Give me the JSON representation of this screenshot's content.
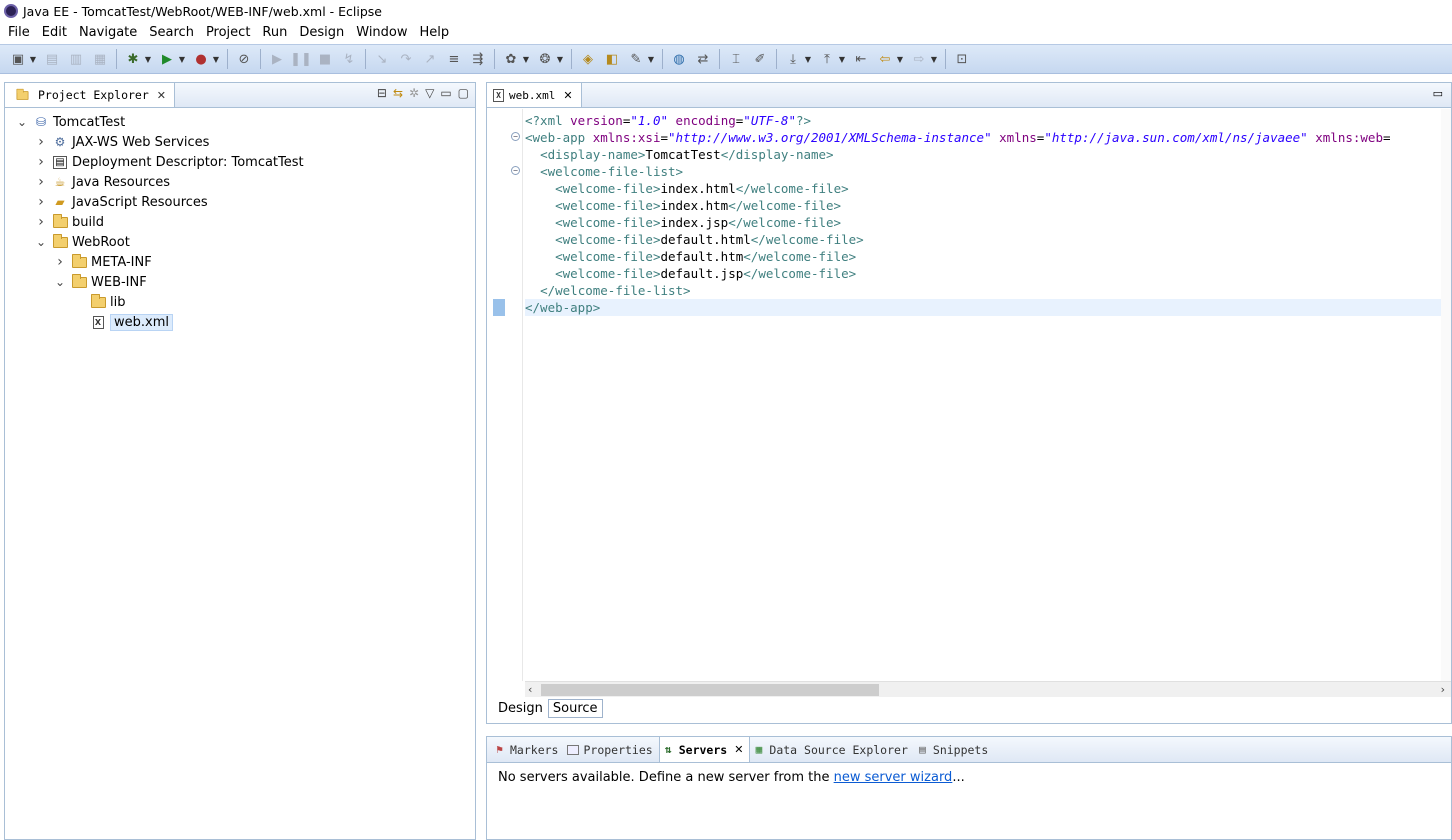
{
  "window": {
    "title": "Java EE - TomcatTest/WebRoot/WEB-INF/web.xml - Eclipse"
  },
  "menu": [
    "File",
    "Edit",
    "Navigate",
    "Search",
    "Project",
    "Run",
    "Design",
    "Window",
    "Help"
  ],
  "project_explorer": {
    "tab_label": "Project Explorer",
    "tree": [
      {
        "label": "TomcatTest",
        "level": 0,
        "twisty": "open",
        "icon": "project-icon"
      },
      {
        "label": "JAX-WS Web Services",
        "level": 1,
        "twisty": "closed",
        "icon": "webservice-icon"
      },
      {
        "label": "Deployment Descriptor: TomcatTest",
        "level": 1,
        "twisty": "closed",
        "icon": "descriptor-icon"
      },
      {
        "label": "Java Resources",
        "level": 1,
        "twisty": "closed",
        "icon": "java-resources-icon"
      },
      {
        "label": "JavaScript Resources",
        "level": 1,
        "twisty": "closed",
        "icon": "javascript-resources-icon"
      },
      {
        "label": "build",
        "level": 1,
        "twisty": "closed",
        "icon": "folder-icon"
      },
      {
        "label": "WebRoot",
        "level": 1,
        "twisty": "open",
        "icon": "folder-icon"
      },
      {
        "label": "META-INF",
        "level": 2,
        "twisty": "closed",
        "icon": "folder-icon"
      },
      {
        "label": "WEB-INF",
        "level": 2,
        "twisty": "open",
        "icon": "folder-icon"
      },
      {
        "label": "lib",
        "level": 3,
        "twisty": "none",
        "icon": "folder-icon"
      },
      {
        "label": "web.xml",
        "level": 3,
        "twisty": "none",
        "icon": "xml-file-icon",
        "selected": true
      }
    ]
  },
  "editor": {
    "tab_label": "web.xml",
    "bottom_tabs": [
      "Design",
      "Source"
    ],
    "active_bottom_tab": "Source",
    "lines": [
      [
        {
          "c": "tag",
          "t": "<?xml "
        },
        {
          "c": "attr",
          "t": "version"
        },
        {
          "c": "txt",
          "t": "="
        },
        {
          "c": "val",
          "t": "\"1.0\""
        },
        {
          "c": "txt",
          "t": " "
        },
        {
          "c": "attr",
          "t": "encoding"
        },
        {
          "c": "txt",
          "t": "="
        },
        {
          "c": "val",
          "t": "\"UTF-8\""
        },
        {
          "c": "tag",
          "t": "?>"
        }
      ],
      [
        {
          "c": "tag",
          "t": "<web-app "
        },
        {
          "c": "attr",
          "t": "xmlns:xsi"
        },
        {
          "c": "txt",
          "t": "="
        },
        {
          "c": "val",
          "t": "\"http://www.w3.org/2001/XMLSchema-instance\""
        },
        {
          "c": "txt",
          "t": " "
        },
        {
          "c": "attr",
          "t": "xmlns"
        },
        {
          "c": "txt",
          "t": "="
        },
        {
          "c": "val",
          "t": "\"http://java.sun.com/xml/ns/javaee\""
        },
        {
          "c": "txt",
          "t": " "
        },
        {
          "c": "attr",
          "t": "xmlns:web"
        },
        {
          "c": "txt",
          "t": "="
        }
      ],
      [
        {
          "c": "txt",
          "t": "  "
        },
        {
          "c": "tag",
          "t": "<display-name>"
        },
        {
          "c": "txt",
          "t": "TomcatTest"
        },
        {
          "c": "tag",
          "t": "</display-name>"
        }
      ],
      [
        {
          "c": "txt",
          "t": "  "
        },
        {
          "c": "tag",
          "t": "<welcome-file-list>"
        }
      ],
      [
        {
          "c": "txt",
          "t": "    "
        },
        {
          "c": "tag",
          "t": "<welcome-file>"
        },
        {
          "c": "txt",
          "t": "index.html"
        },
        {
          "c": "tag",
          "t": "</welcome-file>"
        }
      ],
      [
        {
          "c": "txt",
          "t": "    "
        },
        {
          "c": "tag",
          "t": "<welcome-file>"
        },
        {
          "c": "txt",
          "t": "index.htm"
        },
        {
          "c": "tag",
          "t": "</welcome-file>"
        }
      ],
      [
        {
          "c": "txt",
          "t": "    "
        },
        {
          "c": "tag",
          "t": "<welcome-file>"
        },
        {
          "c": "txt",
          "t": "index.jsp"
        },
        {
          "c": "tag",
          "t": "</welcome-file>"
        }
      ],
      [
        {
          "c": "txt",
          "t": "    "
        },
        {
          "c": "tag",
          "t": "<welcome-file>"
        },
        {
          "c": "txt",
          "t": "default.html"
        },
        {
          "c": "tag",
          "t": "</welcome-file>"
        }
      ],
      [
        {
          "c": "txt",
          "t": "    "
        },
        {
          "c": "tag",
          "t": "<welcome-file>"
        },
        {
          "c": "txt",
          "t": "default.htm"
        },
        {
          "c": "tag",
          "t": "</welcome-file>"
        }
      ],
      [
        {
          "c": "txt",
          "t": "    "
        },
        {
          "c": "tag",
          "t": "<welcome-file>"
        },
        {
          "c": "txt",
          "t": "default.jsp"
        },
        {
          "c": "tag",
          "t": "</welcome-file>"
        }
      ],
      [
        {
          "c": "txt",
          "t": "  "
        },
        {
          "c": "tag",
          "t": "</welcome-file-list>"
        }
      ],
      [
        {
          "c": "tag",
          "t": "</web-app>"
        }
      ]
    ],
    "fold_lines": [
      1,
      3
    ],
    "current_line": 11
  },
  "bottom_views": {
    "tabs": [
      {
        "label": "Markers",
        "icon": "markers-icon"
      },
      {
        "label": "Properties",
        "icon": "properties-icon"
      },
      {
        "label": "Servers",
        "icon": "servers-icon",
        "active": true
      },
      {
        "label": "Data Source Explorer",
        "icon": "data-source-icon"
      },
      {
        "label": "Snippets",
        "icon": "snippets-icon"
      }
    ],
    "servers_message": "No servers available. Define a new server from the ",
    "servers_link": "new server wizard",
    "servers_suffix": "..."
  }
}
